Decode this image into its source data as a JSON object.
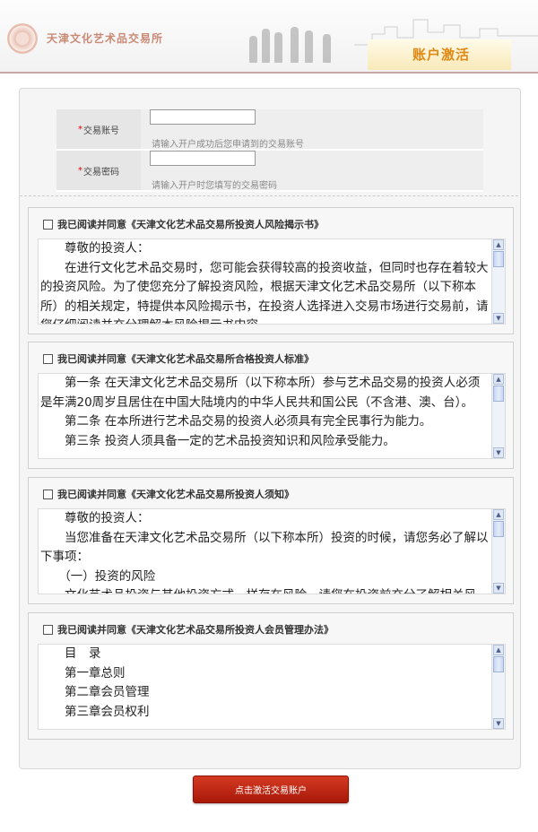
{
  "header": {
    "org_name": "天津文化艺术品交易所",
    "section_title": "账户激活"
  },
  "form": {
    "account": {
      "label": "交易账号",
      "required_mark": "*",
      "value": "",
      "hint": "请输入开户成功后您申请到的交易账号"
    },
    "password": {
      "label": "交易密码",
      "required_mark": "*",
      "value": "",
      "hint": "请输入开户时您填写的交易密码"
    }
  },
  "agreements": [
    {
      "title": "我已阅读并同意《天津文化艺术品交易所投资人风险揭示书》",
      "lines": [
        "　　尊敬的投资人：",
        "　　在进行文化艺术品交易时，您可能会获得较高的投资收益，但同时也存在着较大的投资风险。为了使您充分了解投资风险，根据天津文化艺术品交易所（以下称本所）的相关规定，特提供本风险揭示书，在投资人选择进入交易市场进行交易前，请您仔细阅读并充分理解本风险揭示书内容。"
      ]
    },
    {
      "title": "我已阅读并同意《天津文化艺术品交易所合格投资人标准》",
      "lines": [
        "　　第一条 在天津文化艺术品交易所（以下称本所）参与艺术品交易的投资人必须是年满20周岁且居住在中国大陆境内的中华人民共和国公民（不含港、澳、台）。",
        "　　第二条 在本所进行艺术品交易的投资人必须具有完全民事行为能力。",
        "　　第三条 投资人须具备一定的艺术品投资知识和风险承受能力。"
      ]
    },
    {
      "title": "我已阅读并同意《天津文化艺术品交易所投资人须知》",
      "lines": [
        "　　尊敬的投资人：",
        "　　当您准备在天津文化艺术品交易所（以下称本所）投资的时候，请您务必了解以下事项：",
        "　　（一）投资的风险",
        "　　文化艺术品投资与其他投资方式一样存在风险，请您在投资前充分了解相关风险。"
      ]
    },
    {
      "title": "我已阅读并同意《天津文化艺术品交易所投资人会员管理办法》",
      "lines": [
        "　　目　录",
        "",
        "　　第一章总则",
        "　　第二章会员管理",
        "　　第三章会员权利"
      ]
    }
  ],
  "submit": {
    "label": "点击激活交易账户"
  },
  "icons": {
    "checkbox": "checkbox-icon",
    "scroll_up": "scroll-up-icon",
    "scroll_down": "scroll-down-icon",
    "logo": "logo-icon"
  },
  "colors": {
    "accent": "#e08a16",
    "button": "#c2281a",
    "required": "#dd0000"
  }
}
